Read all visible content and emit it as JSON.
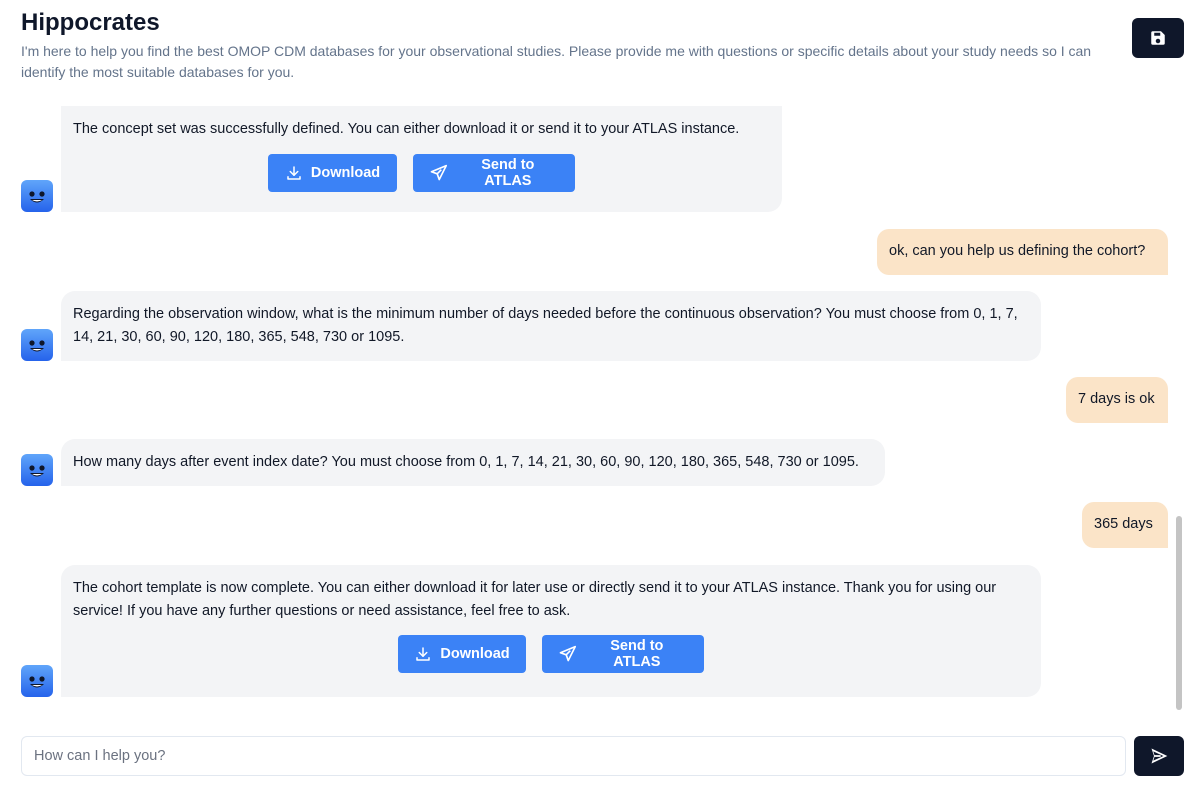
{
  "app": {
    "title": "Hippocrates",
    "subtitle": "I'm here to help you find the best OMOP CDM databases for your observational studies. Please provide me with questions or specific details about your study needs so I can identify the most suitable databases for you."
  },
  "toolbar": {
    "save_icon": "save-icon"
  },
  "messages": [
    {
      "role": "assistant",
      "text": "The concept set was successfully defined. You can either download it or send it to your ATLAS instance.",
      "actions": [
        "Download",
        "Send to ATLAS"
      ]
    },
    {
      "role": "user",
      "text": "ok, can you help us defining the cohort?"
    },
    {
      "role": "assistant",
      "text": "Regarding the observation window, what is the minimum number of days needed before the continuous observation? You must choose from 0, 1, 7, 14, 21, 30, 60, 90, 120, 180, 365, 548, 730 or 1095."
    },
    {
      "role": "user",
      "text": "7 days is ok"
    },
    {
      "role": "assistant",
      "text": "How many days after event index date? You must choose from 0, 1, 7, 14, 21, 30, 60, 90, 120, 180, 365, 548, 730 or 1095."
    },
    {
      "role": "user",
      "text": "365 days"
    },
    {
      "role": "assistant",
      "text": "The cohort template is now complete. You can either download it for later use or directly send it to your ATLAS instance. Thank you for using our service! If you have any further questions or need assistance, feel free to ask.",
      "actions": [
        "Download",
        "Send to ATLAS"
      ]
    }
  ],
  "composer": {
    "placeholder": "How can I help you?",
    "value": ""
  },
  "colors": {
    "accent": "#3b82f6",
    "dark": "#0f172a",
    "bot_bubble": "#f3f4f6",
    "user_bubble": "#fbe4c8"
  }
}
